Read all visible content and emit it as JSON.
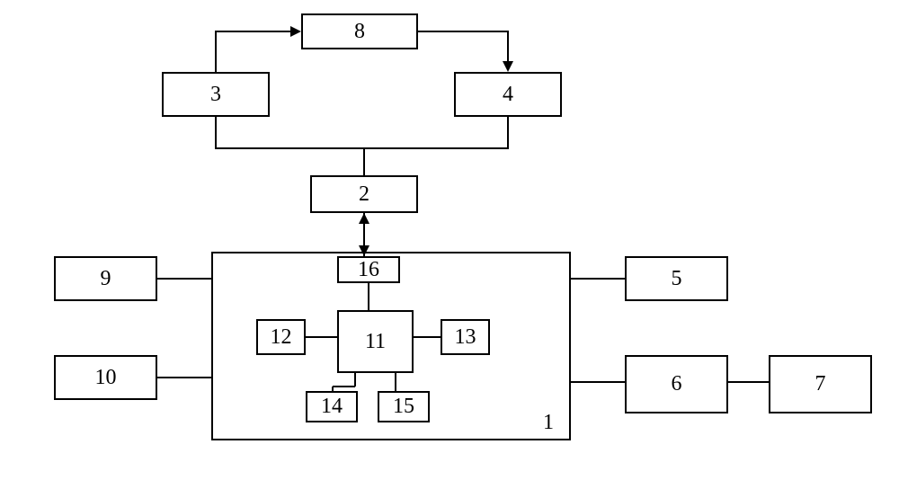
{
  "chart_data": {
    "type": "diagram",
    "title": "",
    "blocks": [
      {
        "id": "1",
        "label": "1"
      },
      {
        "id": "2",
        "label": "2"
      },
      {
        "id": "3",
        "label": "3"
      },
      {
        "id": "4",
        "label": "4"
      },
      {
        "id": "5",
        "label": "5"
      },
      {
        "id": "6",
        "label": "6"
      },
      {
        "id": "7",
        "label": "7"
      },
      {
        "id": "8",
        "label": "8"
      },
      {
        "id": "9",
        "label": "9"
      },
      {
        "id": "10",
        "label": "10"
      },
      {
        "id": "11",
        "label": "11"
      },
      {
        "id": "12",
        "label": "12"
      },
      {
        "id": "13",
        "label": "13"
      },
      {
        "id": "14",
        "label": "14"
      },
      {
        "id": "15",
        "label": "15"
      },
      {
        "id": "16",
        "label": "16"
      }
    ],
    "connections": [
      {
        "from": "3",
        "to": "8",
        "directed": true,
        "via": "up-right"
      },
      {
        "from": "8",
        "to": "4",
        "directed": true,
        "via": "right-down"
      },
      {
        "from": "3",
        "to": "2",
        "directed": false,
        "via": "down-right"
      },
      {
        "from": "4",
        "to": "2",
        "directed": false,
        "via": "down-left"
      },
      {
        "from": "2",
        "to": "16",
        "directed": true,
        "bidirectional": true
      },
      {
        "from": "16",
        "to": "11",
        "directed": false
      },
      {
        "from": "12",
        "to": "11",
        "directed": false
      },
      {
        "from": "11",
        "to": "13",
        "directed": false
      },
      {
        "from": "11",
        "to": "14",
        "directed": false
      },
      {
        "from": "11",
        "to": "15",
        "directed": false
      },
      {
        "from": "9",
        "to": "1",
        "directed": false
      },
      {
        "from": "10",
        "to": "1",
        "directed": false
      },
      {
        "from": "1",
        "to": "5",
        "directed": false
      },
      {
        "from": "1",
        "to": "6",
        "directed": false
      },
      {
        "from": "6",
        "to": "7",
        "directed": false
      }
    ]
  },
  "blocks": {
    "b1": "1",
    "b2": "2",
    "b3": "3",
    "b4": "4",
    "b5": "5",
    "b6": "6",
    "b7": "7",
    "b8": "8",
    "b9": "9",
    "b10": "10",
    "b11": "11",
    "b12": "12",
    "b13": "13",
    "b14": "14",
    "b15": "15",
    "b16": "16"
  }
}
